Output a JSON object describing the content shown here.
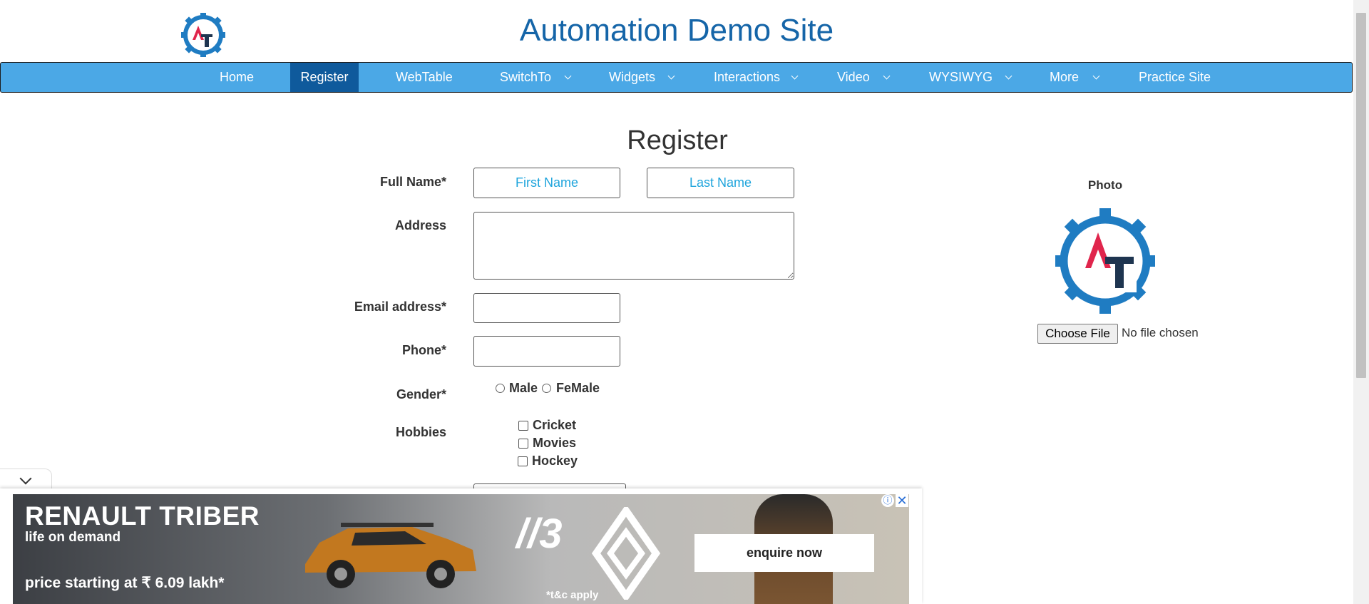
{
  "site": {
    "title": "Automation Demo Site"
  },
  "nav": {
    "items": [
      {
        "label": "Home"
      },
      {
        "label": "Register"
      },
      {
        "label": "WebTable"
      },
      {
        "label": "SwitchTo"
      },
      {
        "label": "Widgets"
      },
      {
        "label": "Interactions"
      },
      {
        "label": "Video"
      },
      {
        "label": "WYSIWYG"
      },
      {
        "label": "More"
      },
      {
        "label": "Practice Site"
      }
    ],
    "active": "Register"
  },
  "form": {
    "title": "Register",
    "full_name_label": "Full Name*",
    "first_name_placeholder": "First Name",
    "last_name_placeholder": "Last Name",
    "address_label": "Address",
    "email_label": "Email address*",
    "phone_label": "Phone*",
    "gender_label": "Gender*",
    "gender_options": [
      "Male",
      "FeMale"
    ],
    "hobbies_label": "Hobbies",
    "hobbies": [
      "Cricket",
      "Movies",
      "Hockey"
    ]
  },
  "photo": {
    "label": "Photo",
    "choose_file": "Choose File",
    "status": "No file chosen"
  },
  "ad": {
    "headline": "RENAULT TRIBER",
    "subline": "life on demand",
    "price": "price starting at ₹ 6.09 lakh*",
    "cta": "enquire now",
    "terms": "*t&c apply",
    "warranty_mark": "//3",
    "close": "✕",
    "info": "ⓘ"
  },
  "colors": {
    "nav_bg": "#4ba8e6",
    "nav_active": "#0f5a9c",
    "title": "#1565a8",
    "placeholder": "#1ea4dc"
  }
}
